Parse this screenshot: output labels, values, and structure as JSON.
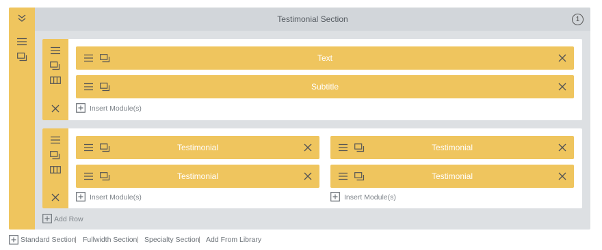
{
  "section": {
    "title": "Testimonial Section",
    "badge": "1"
  },
  "rows": [
    {
      "columns": [
        {
          "modules": [
            {
              "label": "Text"
            },
            {
              "label": "Subtitle"
            }
          ],
          "insert_label": "Insert Module(s)"
        }
      ]
    },
    {
      "columns": [
        {
          "modules": [
            {
              "label": "Testimonial"
            },
            {
              "label": "Testimonial"
            }
          ],
          "insert_label": "Insert Module(s)"
        },
        {
          "modules": [
            {
              "label": "Testimonial"
            },
            {
              "label": "Testimonial"
            }
          ],
          "insert_label": "Insert Module(s)"
        }
      ]
    }
  ],
  "add_row_label": "Add Row",
  "footer": {
    "standard": "Standard Section",
    "fullwidth": "Fullwidth Section",
    "specialty": "Specialty Section",
    "library": "Add From Library",
    "separator": "|"
  },
  "colors": {
    "accent": "#efc55e",
    "section_bg": "#dde0e3",
    "header_bg": "#d2d6da",
    "icon_dark": "#555555"
  }
}
